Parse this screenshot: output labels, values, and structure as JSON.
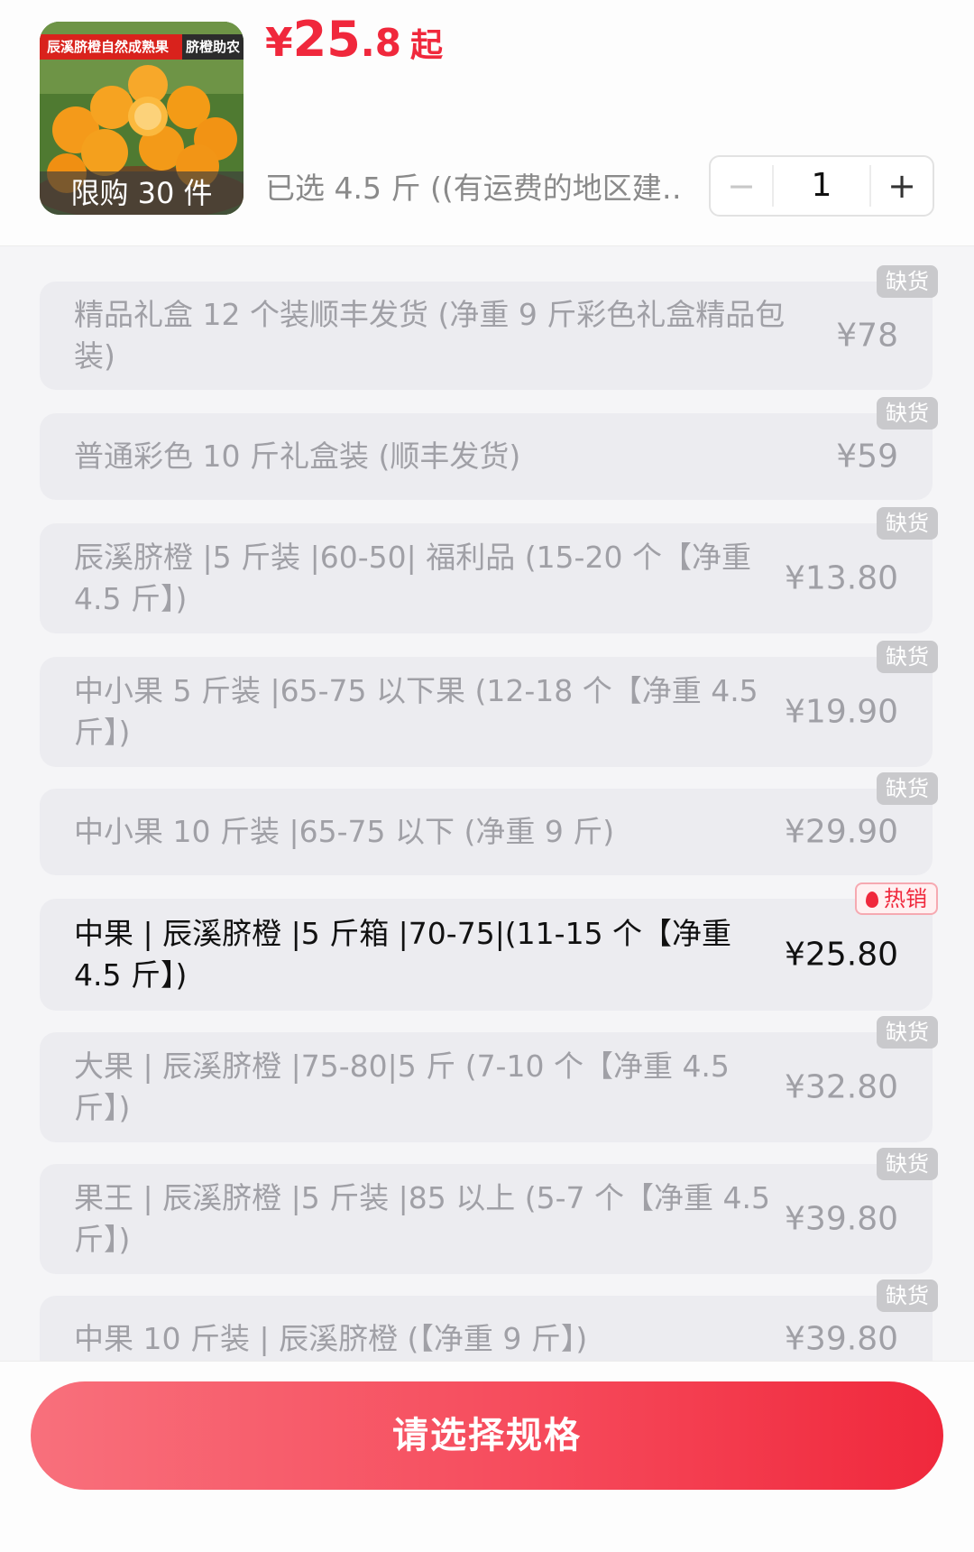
{
  "product": {
    "banner_left": "辰溪脐橙自然成熟果",
    "banner_right": "脐橙助农",
    "limit_text": "限购 30 件",
    "price_symbol": "¥",
    "price_int": "25",
    "price_dec": ".8",
    "price_suffix": "起",
    "selected_text": "已选 4.5 斤 ((有运费的地区建…",
    "image_icon": "orange-product-image"
  },
  "stepper": {
    "minus": "−",
    "value": "1",
    "plus": "+"
  },
  "options": [
    {
      "label": "精品礼盒 12 个装顺丰发货 (净重 9 斤彩色礼盒精品包装)",
      "price": "¥78",
      "badge": "缺货",
      "state": "out"
    },
    {
      "label": "普通彩色 10 斤礼盒装 (顺丰发货)",
      "price": "¥59",
      "badge": "缺货",
      "state": "out"
    },
    {
      "label": "辰溪脐橙 |5 斤装 |60-50| 福利品 (15-20 个【净重 4.5 斤】)",
      "price": "¥13.80",
      "badge": "缺货",
      "state": "out"
    },
    {
      "label": "中小果 5 斤装 |65-75 以下果 (12-18 个【净重 4.5 斤】)",
      "price": "¥19.90",
      "badge": "缺货",
      "state": "out"
    },
    {
      "label": "中小果 10 斤装 |65-75 以下 (净重 9 斤)",
      "price": "¥29.90",
      "badge": "缺货",
      "state": "out"
    },
    {
      "label": "中果 | 辰溪脐橙 |5 斤箱 |70-75|(11-15 个【净重 4.5 斤】)",
      "price": "¥25.80",
      "badge": "热销",
      "state": "hot"
    },
    {
      "label": "大果 | 辰溪脐橙 |75-80|5 斤 (7-10 个【净重 4.5 斤】)",
      "price": "¥32.80",
      "badge": "缺货",
      "state": "out"
    },
    {
      "label": "果王 | 辰溪脐橙 |5 斤装 |85 以上 (5-7 个【净重 4.5 斤】)",
      "price": "¥39.80",
      "badge": "缺货",
      "state": "out"
    },
    {
      "label": "中果 10 斤装 | 辰溪脐橙 (【净重 9 斤】)",
      "price": "¥39.80",
      "badge": "缺货",
      "state": "out"
    }
  ],
  "footer": {
    "cta_label": "请选择规格"
  },
  "colors": {
    "accent": "#f0283c",
    "disabled_text": "#a0a0a6",
    "option_bg": "#ececf0"
  }
}
